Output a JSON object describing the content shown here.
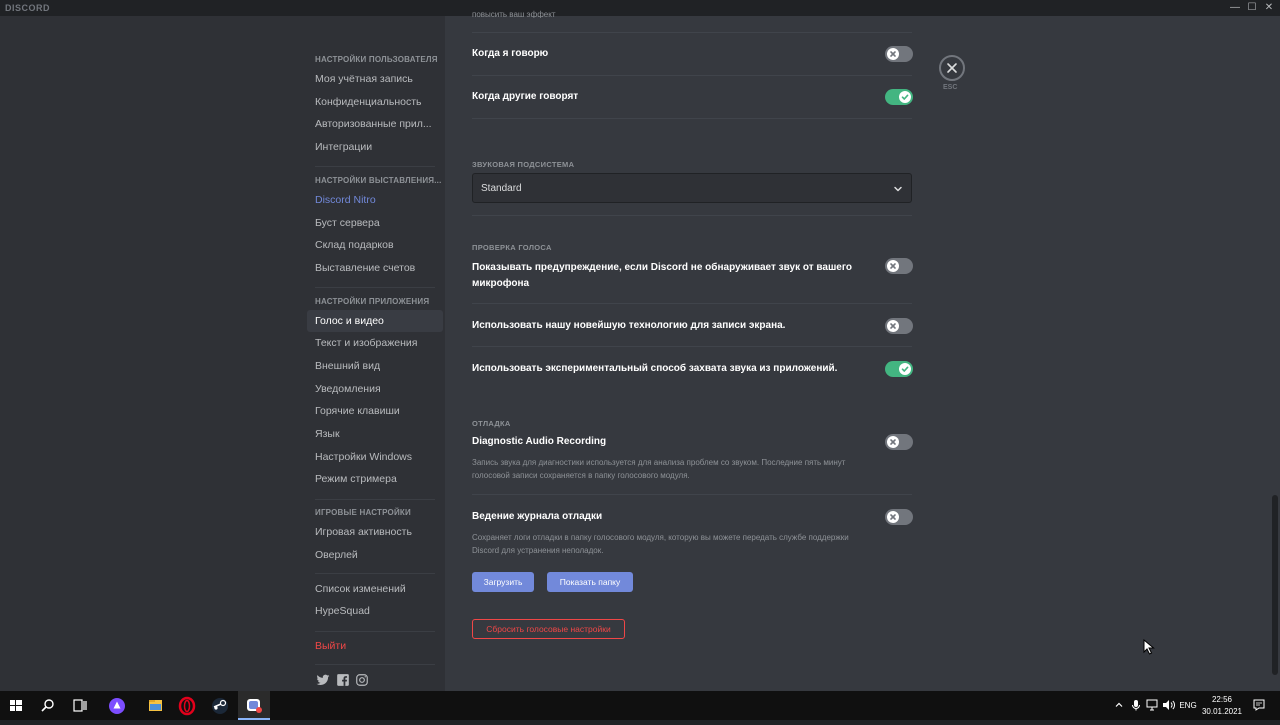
{
  "app": {
    "brand": "DISCORD"
  },
  "window_controls": {
    "minimize": "—",
    "maximize": "☐",
    "close": "✕"
  },
  "sidebar": {
    "sections": [
      {
        "header": "НАСТРОЙКИ ПОЛЬЗОВАТЕЛЯ",
        "items": [
          "Моя учётная запись",
          "Конфиденциальность",
          "Авторизованные прил...",
          "Интеграции"
        ]
      },
      {
        "header": "НАСТРОЙКИ ВЫСТАВЛЕНИЯ...",
        "items": [
          "Discord Nitro",
          "Буст сервера",
          "Склад подарков",
          "Выставление счетов"
        ]
      },
      {
        "header": "НАСТРОЙКИ ПРИЛОЖЕНИЯ",
        "items": [
          "Голос и видео",
          "Текст и изображения",
          "Внешний вид",
          "Уведомления",
          "Горячие клавиши",
          "Язык",
          "Настройки Windows",
          "Режим стримера"
        ]
      },
      {
        "header": "ИГРОВЫЕ НАСТРОЙКИ",
        "items": [
          "Игровая активность",
          "Оверлей"
        ]
      }
    ],
    "extra_items": [
      "Список изменений",
      "HypeSquad"
    ],
    "logout": "Выйти",
    "active_item": "Голос и видео",
    "social_icons": [
      "twitter-icon",
      "facebook-icon",
      "instagram-icon"
    ]
  },
  "content": {
    "cut_top_text": "повысить ваш эффект",
    "rows_top": [
      {
        "label": "Когда я говорю",
        "enabled": false
      },
      {
        "label": "Когда другие говорят",
        "enabled": true
      }
    ],
    "audio_subsystem": {
      "title": "ЗВУКОВАЯ ПОДСИСТЕМА",
      "value": "Standard"
    },
    "voice_check": {
      "title": "ПРОВЕРКА ГОЛОСА",
      "rows": [
        {
          "label_line1": "Показывать предупреждение, если Discord не обнаруживает звук от вашего",
          "label_line2": "микрофона",
          "enabled": false
        },
        {
          "label": "Использовать нашу новейшую технологию для записи экрана.",
          "enabled": false
        },
        {
          "label": "Использовать экспериментальный способ захвата звука из приложений.",
          "enabled": true
        }
      ]
    },
    "debug": {
      "title": "ОТЛАДКА",
      "diag": {
        "label": "Diagnostic Audio Recording",
        "enabled": false,
        "desc_line1": "Запись звука для диагностики используется для анализа проблем со звуком. Последние пять минут",
        "desc_line2": "голосовой записи сохраняется в папку голосового модуля."
      },
      "log": {
        "label": "Ведение журнала отладки",
        "enabled": false,
        "desc_line1": "Сохраняет логи отладки в папку голосового модуля, которую вы можете передать службе поддержки",
        "desc_line2": "Discord для устранения неполадок."
      },
      "upload_button": "Загрузить",
      "show_folder_button": "Показать папку"
    },
    "reset_button": "Сбросить голосовые настройки",
    "esc_label": "ESC"
  },
  "taskbar": {
    "icons": [
      "windows-start-icon",
      "search-icon",
      "task-view-icon",
      "assistant-icon",
      "file-explorer-icon",
      "opera-icon",
      "steam-icon",
      "discord-icon"
    ],
    "language": "ENG",
    "time": "22:56",
    "date": "30.01.2021"
  },
  "colors": {
    "accent": "#7289da",
    "toggle_on": "#43b581",
    "danger": "#f04747",
    "background": "#36393f",
    "sidebar": "#2f3136"
  }
}
